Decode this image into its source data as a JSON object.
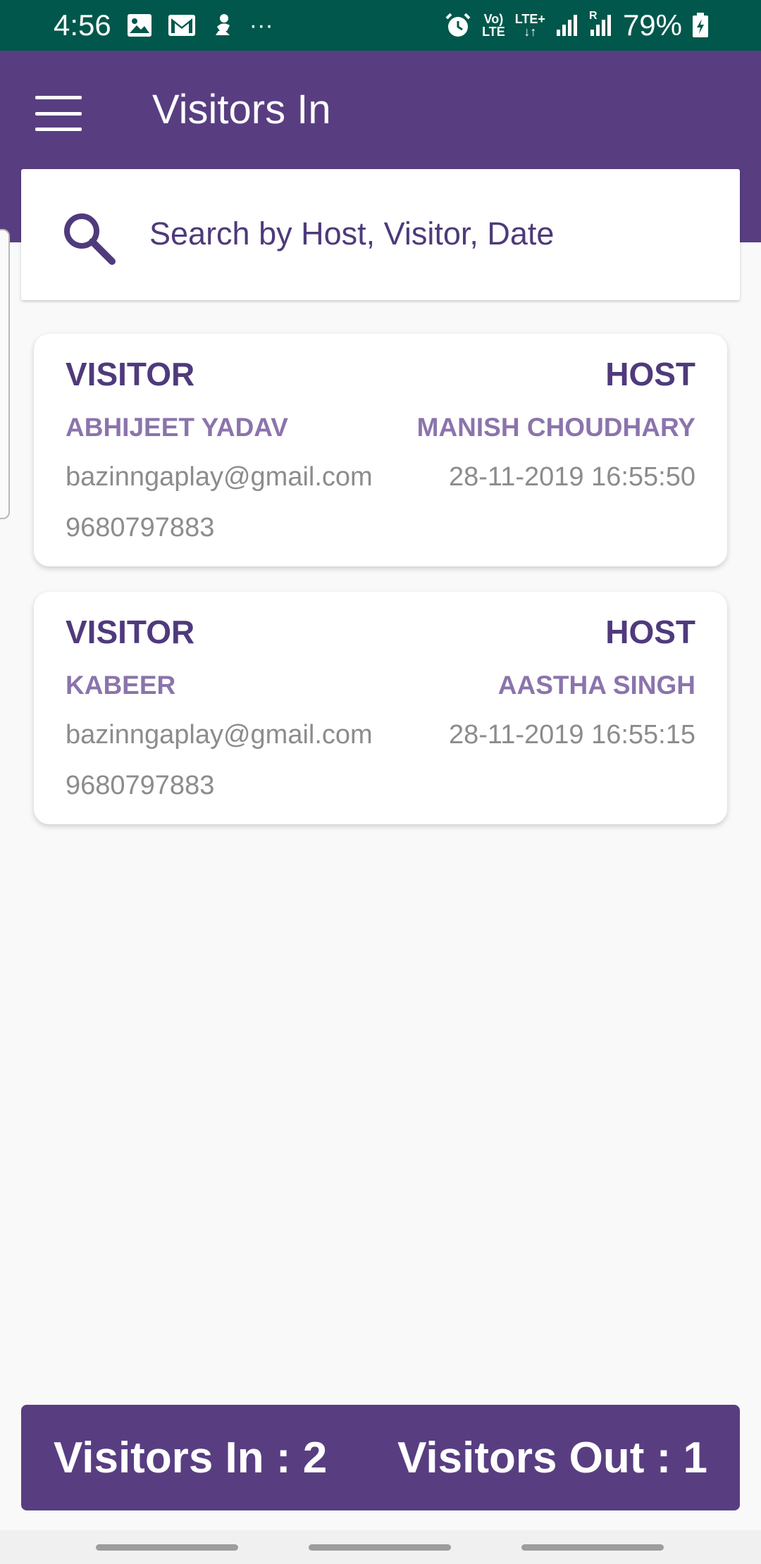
{
  "status_bar": {
    "time": "4:56",
    "left_icons": [
      "image-icon",
      "gmail-icon",
      "app-notification-icon",
      "more-dots-icon"
    ],
    "more_dots": "···",
    "volte_line1": "Vo)",
    "volte_line2": "LTE",
    "lte_line1": "LTE+",
    "lte_line2": "↓↑",
    "roaming_mark": "R",
    "battery_percent": "79%",
    "background_color": "#01574b"
  },
  "app_bar": {
    "title": "Visitors In",
    "background_color": "#583e81"
  },
  "search": {
    "placeholder": "Search by Host, Visitor, Date",
    "value": ""
  },
  "visitors": [
    {
      "visitor_label": "VISITOR",
      "host_label": "HOST",
      "visitor_name": "ABHIJEET YADAV",
      "host_name": "MANISH CHOUDHARY",
      "email": "bazinngaplay@gmail.com",
      "datetime": "28-11-2019 16:55:50",
      "phone": "9680797883"
    },
    {
      "visitor_label": "VISITOR",
      "host_label": "HOST",
      "visitor_name": "KABEER",
      "host_name": "AASTHA SINGH",
      "email": "bazinngaplay@gmail.com",
      "datetime": "28-11-2019 16:55:15",
      "phone": "9680797883"
    }
  ],
  "footer": {
    "visitors_in": "Visitors In : 2",
    "visitors_out": "Visitors Out : 1"
  },
  "colors": {
    "primary": "#583e81",
    "label_dark": "#4f3a7c",
    "label_light": "#8b74ac",
    "meta_gray": "#8c8c8c"
  }
}
